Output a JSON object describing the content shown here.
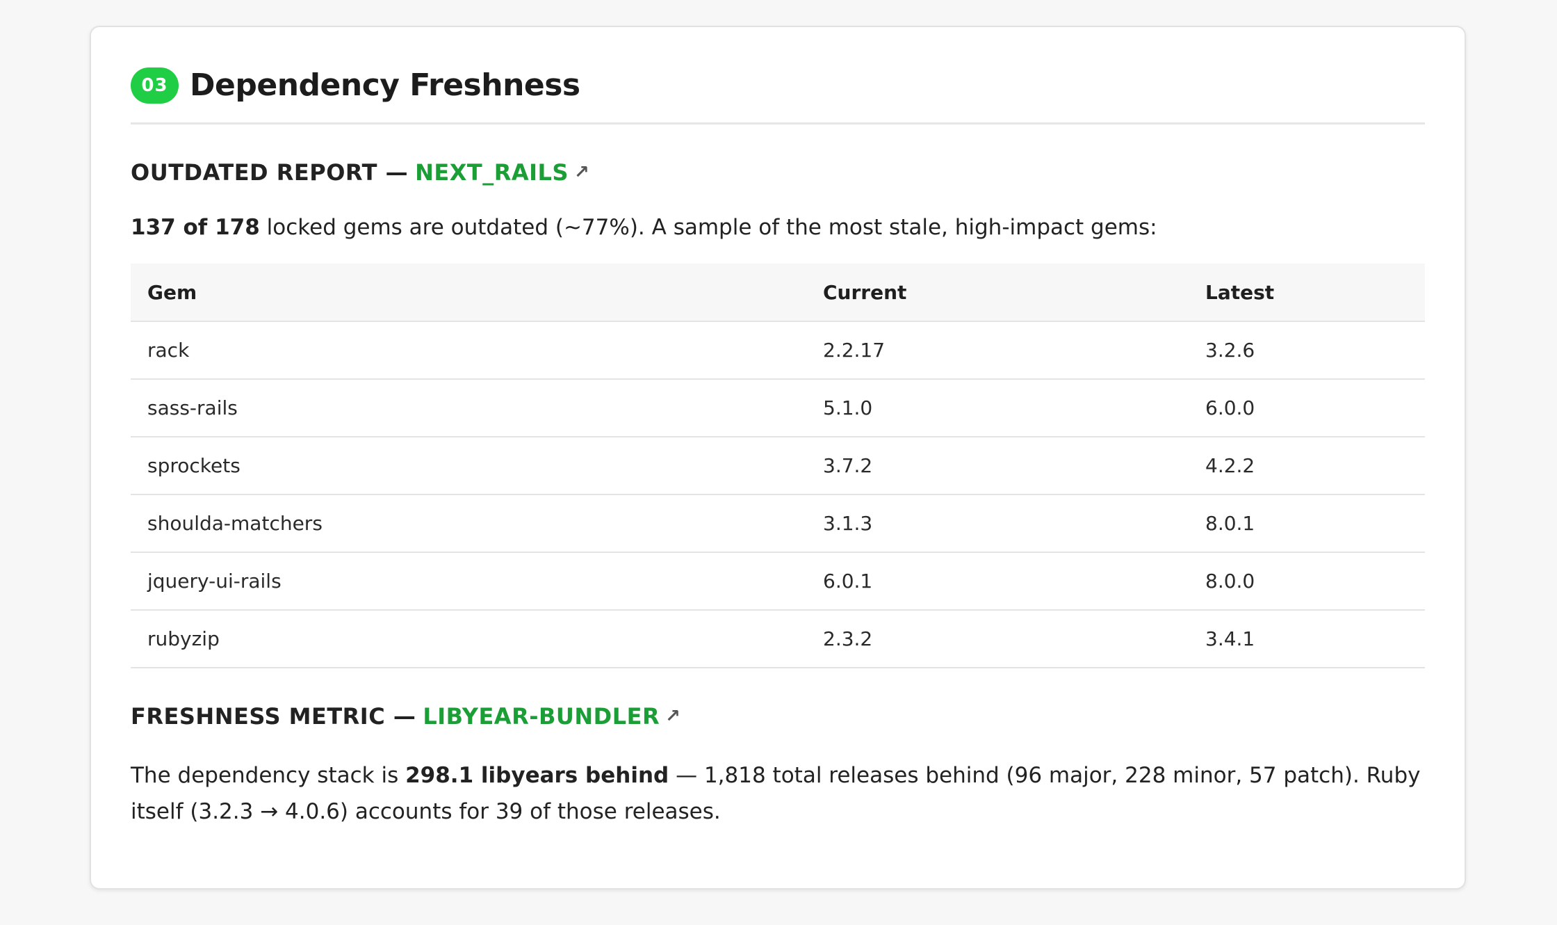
{
  "header": {
    "badge": "03",
    "title": "Dependency Freshness"
  },
  "outdated": {
    "heading_prefix": "OUTDATED REPORT —",
    "heading_link": "NEXT_RAILS",
    "ext_icon": "↗",
    "intro_bold": "137 of 178",
    "intro_rest": " locked gems are outdated (~77%). A sample of the most stale, high-impact gems:",
    "table": {
      "headers": [
        "Gem",
        "Current",
        "Latest"
      ],
      "rows": [
        [
          "rack",
          "2.2.17",
          "3.2.6"
        ],
        [
          "sass-rails",
          "5.1.0",
          "6.0.0"
        ],
        [
          "sprockets",
          "3.7.2",
          "4.2.2"
        ],
        [
          "shoulda-matchers",
          "3.1.3",
          "8.0.1"
        ],
        [
          "jquery-ui-rails",
          "6.0.1",
          "8.0.0"
        ],
        [
          "rubyzip",
          "2.3.2",
          "3.4.1"
        ]
      ]
    }
  },
  "freshness": {
    "heading_prefix": "FRESHNESS METRIC —",
    "heading_link": "LIBYEAR-BUNDLER",
    "ext_icon": "↗",
    "para_pre": "The dependency stack is ",
    "para_bold": "298.1 libyears behind",
    "para_post": " — 1,818 total releases behind (96 major, 228 minor, 57 patch). Ruby itself (3.2.3 → 4.0.6) accounts for 39 of those releases."
  },
  "colors": {
    "badge": "#1fce45",
    "link": "#1a9e35"
  }
}
